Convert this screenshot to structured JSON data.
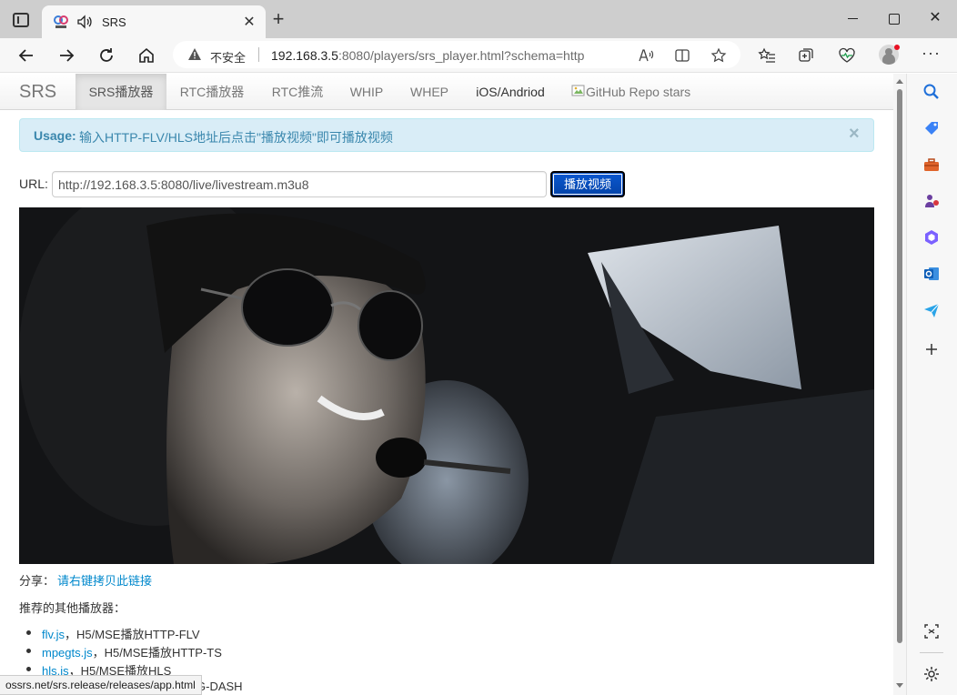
{
  "browser": {
    "tab_title": "SRS",
    "tab_close": "✕",
    "new_tab": "+",
    "address": {
      "insecure_label": "不安全",
      "url_host": "192.168.3.5",
      "url_rest": ":8080/players/srs_player.html?schema=http"
    },
    "window": {
      "close": "✕"
    },
    "more": "···"
  },
  "site": {
    "brand": "SRS",
    "nav": [
      {
        "label": "SRS播放器"
      },
      {
        "label": "RTC播放器"
      },
      {
        "label": "RTC推流"
      },
      {
        "label": "WHIP"
      },
      {
        "label": "WHEP"
      },
      {
        "label": "iOS/Andriod"
      },
      {
        "label": "GitHub Repo stars"
      }
    ]
  },
  "alert": {
    "strong": "Usage:",
    "text": "输入HTTP-FLV/HLS地址后点击\"播放视频\"即可播放视频",
    "close": "×"
  },
  "form": {
    "url_label": "URL:",
    "url_value": "http://192.168.3.5:8080/live/livestream.m3u8",
    "play_label": "播放视频"
  },
  "share": {
    "label": "分享：",
    "link_text": "请右键拷贝此链接"
  },
  "recommend": {
    "title": "推荐的其他播放器：",
    "items": [
      {
        "link": "flv.js",
        "desc": "，H5/MSE播放HTTP-FLV"
      },
      {
        "link": "mpegts.js",
        "desc": "，H5/MSE播放HTTP-TS"
      },
      {
        "link": "hls.js",
        "desc": "，H5/MSE播放HLS"
      },
      {
        "link": "",
        "desc": "G-DASH"
      }
    ]
  },
  "status_bar": {
    "url": "ossrs.net/srs.release/releases/app.html"
  },
  "colors": {
    "accent": "#0a58d0",
    "link": "#0088cc",
    "alert_bg": "#d9edf7",
    "alert_text": "#3a87ad"
  }
}
